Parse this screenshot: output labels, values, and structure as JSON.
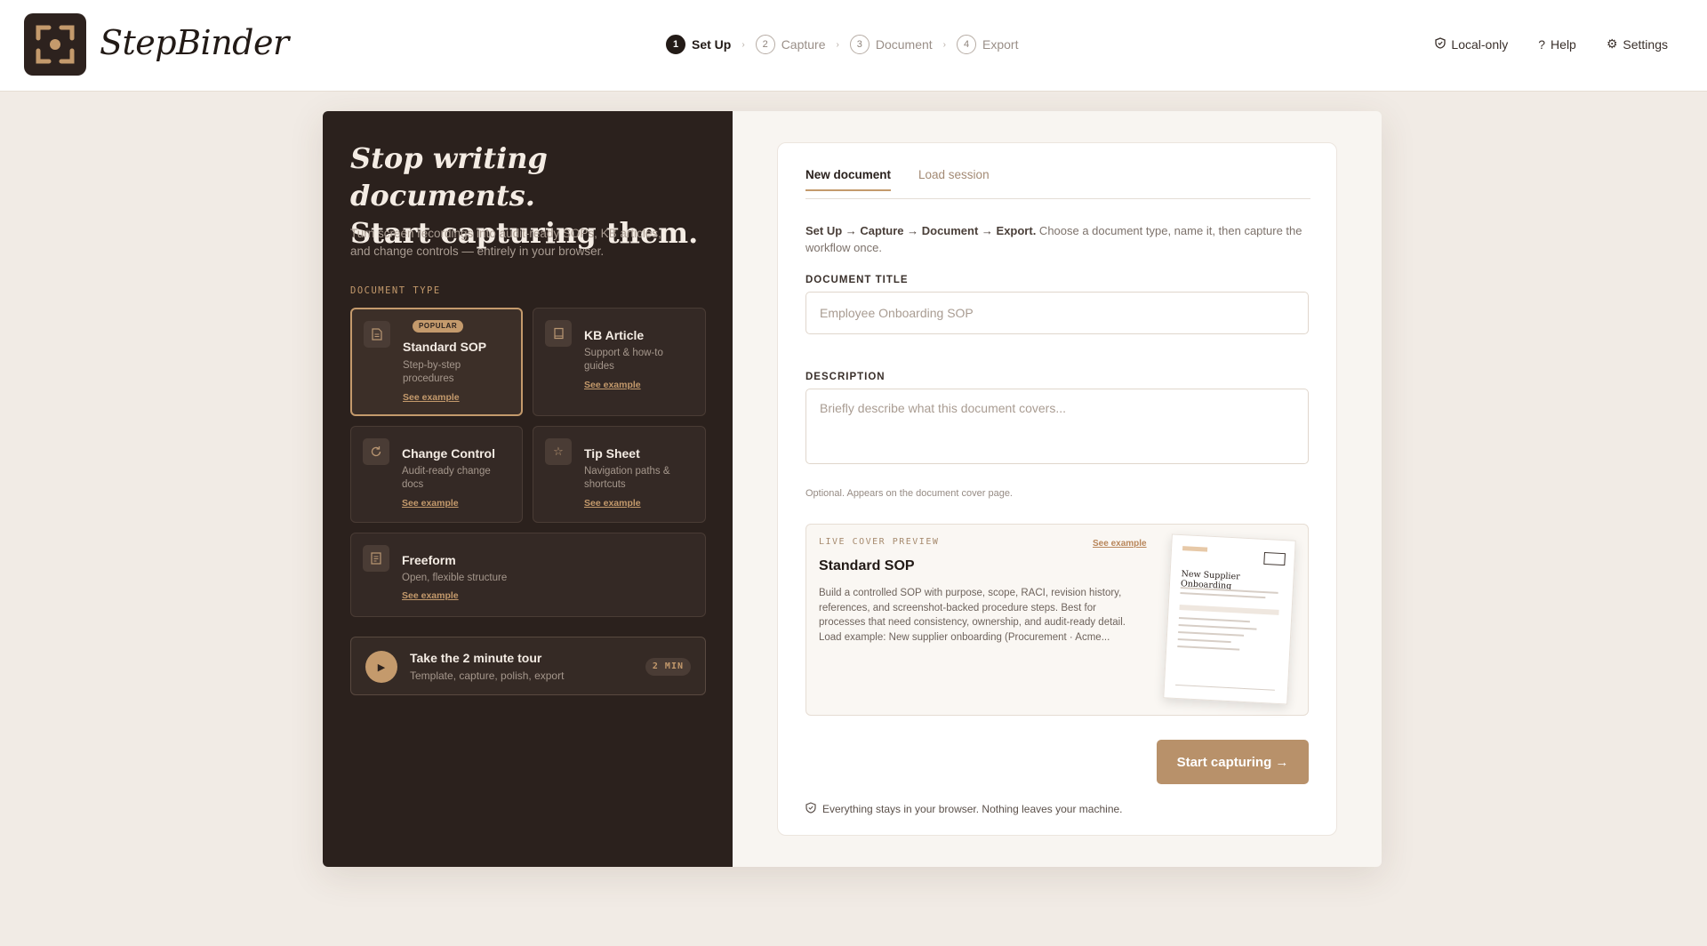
{
  "app": {
    "name": "StepBinder"
  },
  "stepper": [
    {
      "num": "1",
      "label": "Set Up",
      "active": true
    },
    {
      "num": "2",
      "label": "Capture",
      "active": false
    },
    {
      "num": "3",
      "label": "Document",
      "active": false
    },
    {
      "num": "4",
      "label": "Export",
      "active": false
    }
  ],
  "top_actions": {
    "local": "Local-only",
    "help": "Help",
    "settings": "Settings"
  },
  "hero": {
    "line1": "Stop writing documents.",
    "line2": "Start capturing them.",
    "sub": "Turn screen recordings into audit-ready SOPs, KB articles, and change controls — entirely in your browser."
  },
  "doc_type_label": "DOCUMENT TYPE",
  "doc_types": [
    {
      "title": "Standard SOP",
      "desc": "Step-by-step procedures",
      "link": "See example",
      "badge": "POPULAR",
      "icon": "document-icon"
    },
    {
      "title": "KB Article",
      "desc": "Support & how-to guides",
      "link": "See example",
      "icon": "book-icon"
    },
    {
      "title": "Change Control",
      "desc": "Audit-ready change docs",
      "link": "See example",
      "icon": "refresh-icon"
    },
    {
      "title": "Tip Sheet",
      "desc": "Navigation paths & shortcuts",
      "link": "See example",
      "icon": "star-icon"
    },
    {
      "title": "Freeform",
      "desc": "Open, flexible structure",
      "link": "See example",
      "icon": "note-icon"
    }
  ],
  "tour": {
    "title": "Take the 2 minute tour",
    "sub": "Template, capture, polish, export",
    "badge": "2 MIN"
  },
  "tabs": {
    "new": "New document",
    "load": "Load session"
  },
  "intro": {
    "bold": "Set Up → Capture → Document → Export.",
    "text": " Choose a document type, name it, then capture the workflow once."
  },
  "fields": {
    "title_label": "DOCUMENT TITLE",
    "title_placeholder": "Employee Onboarding SOP",
    "title_value": "",
    "desc_label": "DESCRIPTION",
    "desc_placeholder": "Briefly describe what this document covers...",
    "desc_value": "",
    "hint": "Optional. Appears on the document cover page."
  },
  "preview": {
    "label": "LIVE COVER PREVIEW",
    "link": "See example",
    "title": "Standard SOP",
    "text": "Build a controlled SOP with purpose, scope, RACI, revision history, references, and screenshot-backed procedure steps. Best for processes that need consistency, ownership, and audit-ready detail. Load example: New supplier onboarding (Procurement · Acme...",
    "thumb_title": "New Supplier Onboarding"
  },
  "cta": "Start capturing →",
  "privacy": "Everything stays in your browser. Nothing leaves your machine.",
  "colors": {
    "accent": "#c49a6c",
    "dark_panel": "#2b211d",
    "cta": "#b8916a"
  }
}
